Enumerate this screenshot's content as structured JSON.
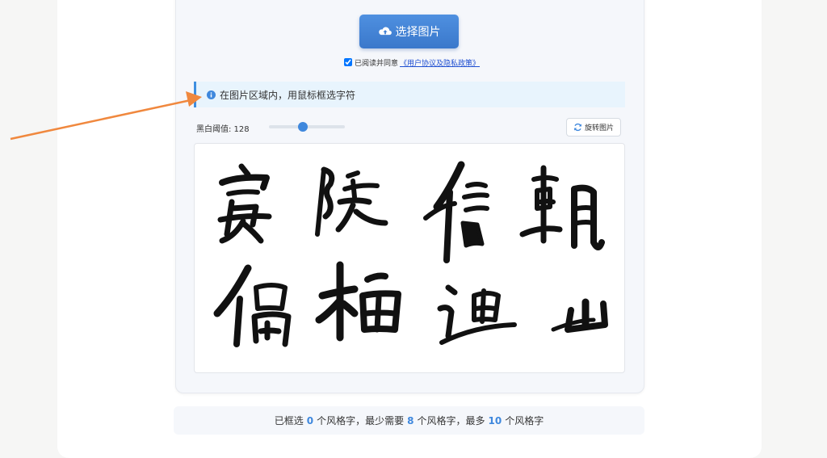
{
  "upload": {
    "select_button": "选择图片",
    "agree_prefix": "已阅读并同意",
    "agree_link": "《用户协议及隐私政策》",
    "agree_checked": true
  },
  "notice": {
    "text": "在图片区域内，用鼠标框选字符",
    "icon": "info-circle-icon"
  },
  "controls": {
    "threshold_label": "黑白阈值: 128",
    "threshold_value": 128,
    "threshold_max": 255,
    "rotate_button": "旋转图片",
    "rotate_icon": "refresh-icon"
  },
  "image": {
    "characters": [
      "宴",
      "陵",
      "信",
      "朝",
      "偶",
      "梅",
      "迪",
      "山"
    ]
  },
  "status": {
    "part1": "已框选",
    "selected": "0",
    "part2": "个风格字，最少需要",
    "min": "8",
    "part3": "个风格字，最多",
    "max": "10",
    "part4": "个风格字"
  },
  "colors": {
    "accent": "#3f88dd",
    "annotation_arrow": "#f0883e"
  }
}
